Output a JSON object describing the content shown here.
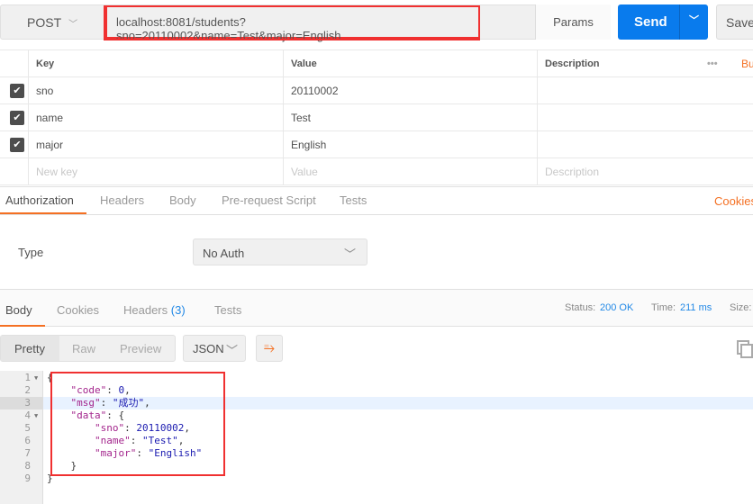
{
  "request": {
    "method": "POST",
    "url": "localhost:8081/students?sno=20110002&name=Test&major=English",
    "params_label": "Params",
    "send_label": "Send",
    "save_label": "Save"
  },
  "params_table": {
    "headers": [
      "Key",
      "Value",
      "Description"
    ],
    "bulk_label": "Bu",
    "rows": [
      {
        "key": "sno",
        "value": "20110002",
        "checked": true
      },
      {
        "key": "name",
        "value": "Test",
        "checked": true
      },
      {
        "key": "major",
        "value": "English",
        "checked": true
      }
    ],
    "new_key_placeholder": "New key",
    "new_value_placeholder": "Value",
    "new_desc_placeholder": "Description"
  },
  "request_tabs": [
    "Authorization",
    "Headers",
    "Body",
    "Pre-request Script",
    "Tests"
  ],
  "cookies_link": "Cookies",
  "auth": {
    "type_label": "Type",
    "type_value": "No Auth"
  },
  "response_tabs": [
    "Body",
    "Cookies",
    "Headers",
    "Tests"
  ],
  "headers_count": "(3)",
  "status": {
    "status_label": "Status:",
    "status_value": "200 OK",
    "time_label": "Time:",
    "time_value": "211 ms",
    "size_label": "Size:"
  },
  "format_buttons": [
    "Pretty",
    "Raw",
    "Preview"
  ],
  "format_select": "JSON",
  "code_lines": [
    [
      [
        "p",
        "{"
      ]
    ],
    [
      [
        "p",
        "    "
      ],
      [
        "k",
        "\"code\""
      ],
      [
        "p",
        ": "
      ],
      [
        "n",
        "0"
      ],
      [
        "p",
        ","
      ]
    ],
    [
      [
        "p",
        "    "
      ],
      [
        "k",
        "\"msg\""
      ],
      [
        "p",
        ": "
      ],
      [
        "s",
        "\"成功\""
      ],
      [
        "p",
        ","
      ]
    ],
    [
      [
        "p",
        "    "
      ],
      [
        "k",
        "\"data\""
      ],
      [
        "p",
        ": {"
      ]
    ],
    [
      [
        "p",
        "        "
      ],
      [
        "k",
        "\"sno\""
      ],
      [
        "p",
        ": "
      ],
      [
        "n",
        "20110002"
      ],
      [
        "p",
        ","
      ]
    ],
    [
      [
        "p",
        "        "
      ],
      [
        "k",
        "\"name\""
      ],
      [
        "p",
        ": "
      ],
      [
        "s",
        "\"Test\""
      ],
      [
        "p",
        ","
      ]
    ],
    [
      [
        "p",
        "        "
      ],
      [
        "k",
        "\"major\""
      ],
      [
        "p",
        ": "
      ],
      [
        "s",
        "\"English\""
      ]
    ],
    [
      [
        "p",
        "    }"
      ]
    ],
    [
      [
        "p",
        "}"
      ]
    ]
  ]
}
